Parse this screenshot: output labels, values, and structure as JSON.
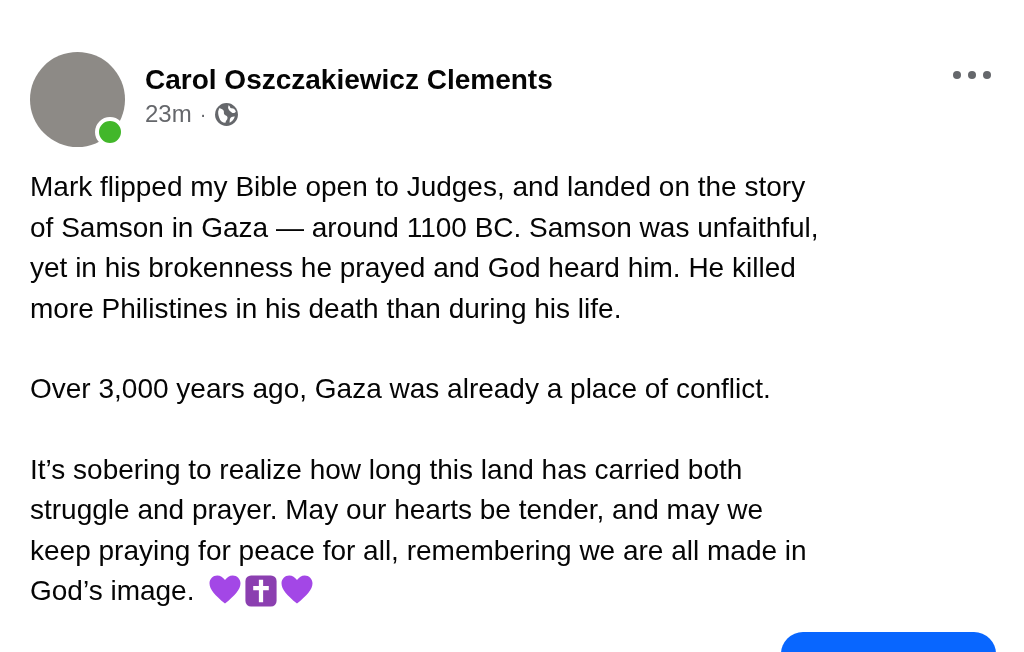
{
  "post": {
    "author": "Carol Oszczakiewicz Clements",
    "online": true,
    "time": "23m",
    "separator": "·",
    "paragraphs": [
      [
        "Mark flipped my Bible open to Judges, and landed on the story",
        "of Samson in Gaza — around 1100 BC. Samson was unfaithful,",
        "yet in his brokenness he prayed and God heard him.  He killed",
        "more Philistines in his death than during his life."
      ],
      [
        "Over 3,000 years ago, Gaza was already a place of conflict."
      ],
      [
        "It’s sobering to realize how long this land has carried both",
        "struggle and prayer. May our hearts be tender, and may we",
        "keep praying for peace for all, remembering we are all made in",
        "God’s image."
      ]
    ]
  }
}
